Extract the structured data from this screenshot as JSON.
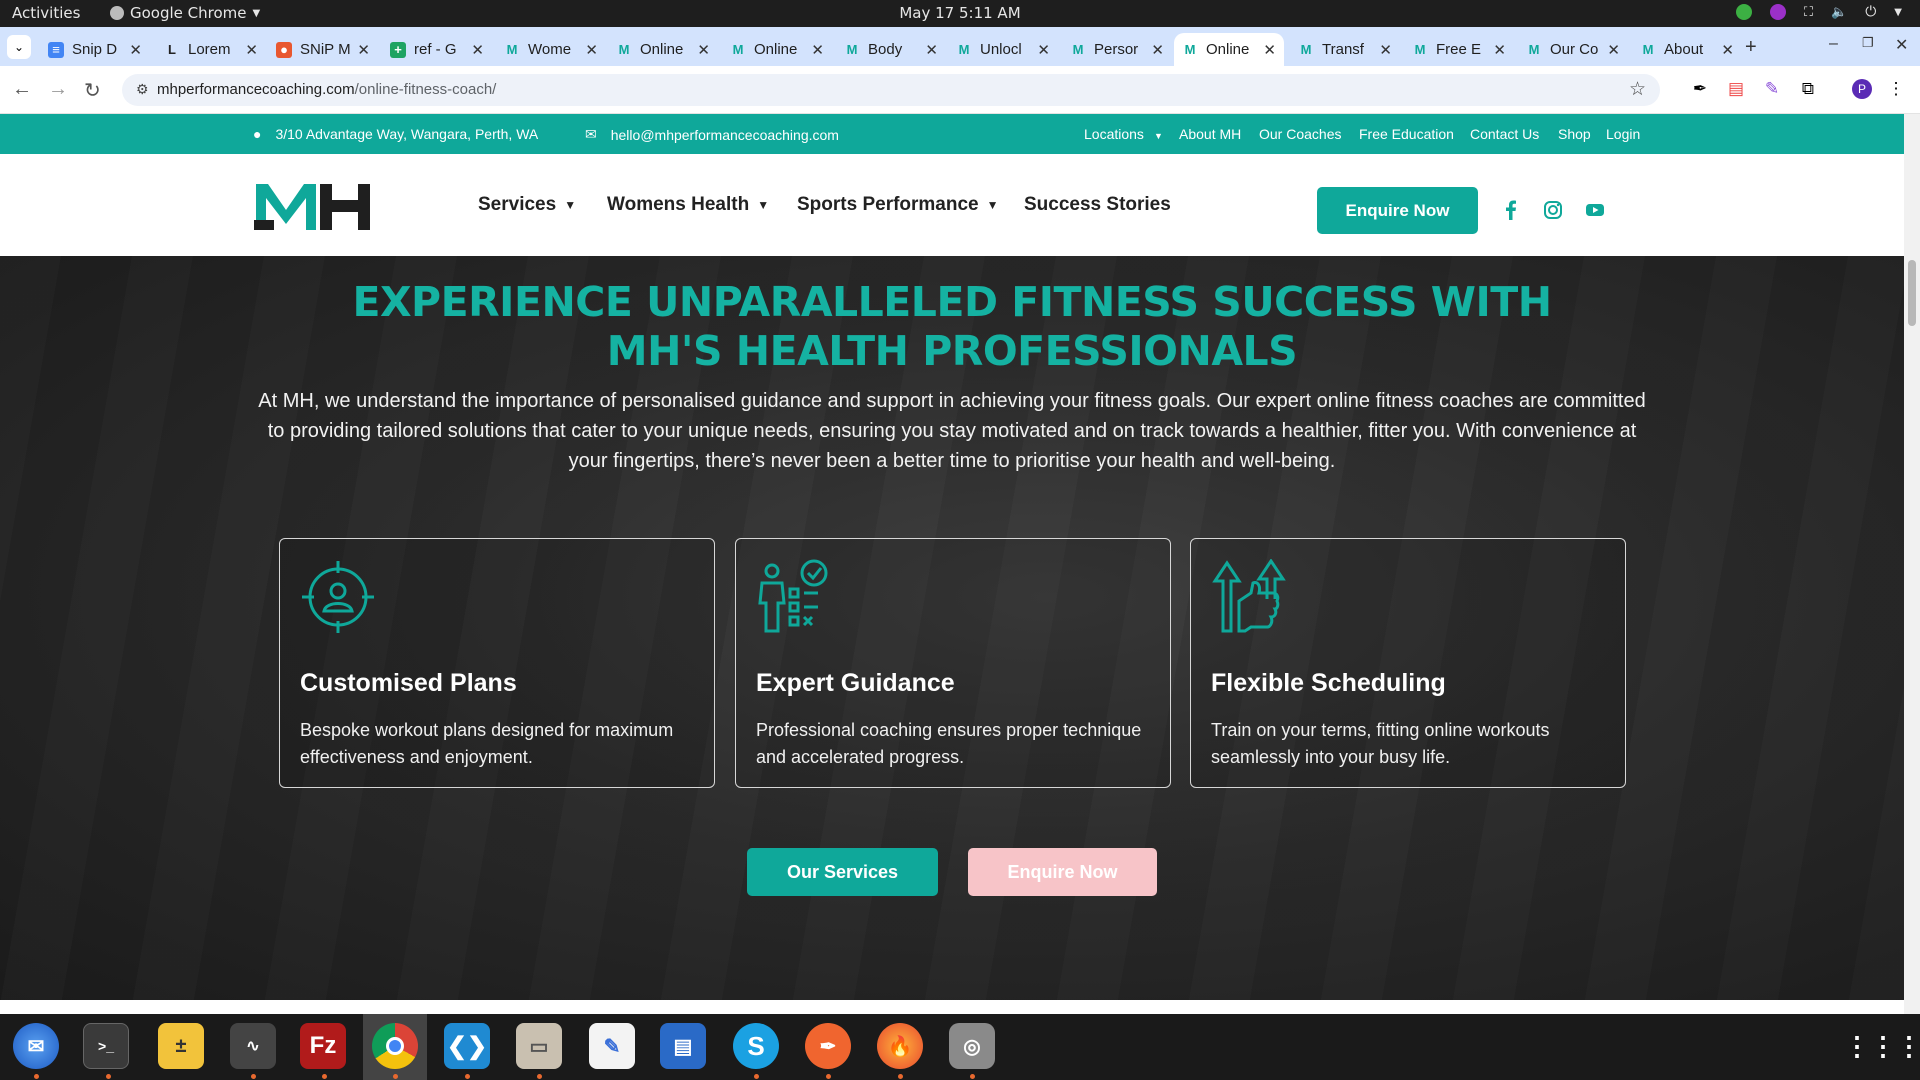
{
  "os": {
    "activities": "Activities",
    "app_name": "Google Chrome",
    "clock": "May 17  5:11 AM"
  },
  "browser": {
    "tabs": [
      {
        "label": "Snip D",
        "color": "#4285f4",
        "glyph": "≡"
      },
      {
        "label": "Lorem",
        "color": "#ffffff",
        "glyph": "L"
      },
      {
        "label": "SNiP M",
        "color": "#e8572f",
        "glyph": "●"
      },
      {
        "label": "ref - G",
        "color": "#1ea362",
        "glyph": "+"
      },
      {
        "label": "Wome",
        "color": "#0fa89a",
        "glyph": "M"
      },
      {
        "label": "Online",
        "color": "#0fa89a",
        "glyph": "M"
      },
      {
        "label": "Online",
        "color": "#0fa89a",
        "glyph": "M"
      },
      {
        "label": "Body",
        "color": "#0fa89a",
        "glyph": "M"
      },
      {
        "label": "Unlocl",
        "color": "#0fa89a",
        "glyph": "M"
      },
      {
        "label": "Persor",
        "color": "#0fa89a",
        "glyph": "M"
      },
      {
        "label": "Online",
        "color": "#0fa89a",
        "glyph": "M",
        "active": true
      },
      {
        "label": "Transf",
        "color": "#0fa89a",
        "glyph": "M"
      },
      {
        "label": "Free E",
        "color": "#0fa89a",
        "glyph": "M"
      },
      {
        "label": "Our Co",
        "color": "#0fa89a",
        "glyph": "M"
      },
      {
        "label": "About",
        "color": "#0fa89a",
        "glyph": "M"
      }
    ],
    "new_tab": "+",
    "url_domain": "mhperformancecoaching.com",
    "url_path": "/online-fitness-coach/",
    "profile_initial": "P"
  },
  "site": {
    "brand_color": "#0fa89a",
    "address": "3/10 Advantage Way, Wangara, Perth, WA",
    "email": "hello@mhperformancecoaching.com",
    "top_links": {
      "locations": "Locations",
      "about": "About MH",
      "coaches": "Our Coaches",
      "education": "Free Education",
      "contact": "Contact Us",
      "shop": "Shop",
      "login": "Login"
    },
    "nav": {
      "services": "Services",
      "womens_health": "Womens Health",
      "sports_performance": "Sports Performance",
      "success_stories": "Success Stories",
      "enquire": "Enquire Now"
    },
    "hero": {
      "title": "EXPERIENCE UNPARALLELED FITNESS SUCCESS WITH MH'S HEALTH PROFESSIONALS",
      "intro": "At MH, we understand the importance of personalised guidance and support in achieving your fitness goals. Our expert online fitness coaches are committed to providing tailored solutions that cater to your unique needs, ensuring you stay motivated and on track towards a healthier, fitter you. With convenience at your fingertips, there’s never been a better time to prioritise your health and well-being.",
      "cards": [
        {
          "title": "Customised Plans",
          "text": "Bespoke workout plans designed for maximum effectiveness and enjoyment.",
          "icon": "target-person-icon"
        },
        {
          "title": "Expert Guidance",
          "text": "Professional coaching ensures proper technique and accelerated progress.",
          "icon": "coach-checklist-icon"
        },
        {
          "title": "Flexible Scheduling",
          "text": "Train on your terms, fitting online workouts seamlessly into your busy life.",
          "icon": "thumbs-up-arrows-icon"
        }
      ],
      "btn_services": "Our Services",
      "btn_enquire": "Enquire Now",
      "enquire_color": "#f7c4c8"
    }
  }
}
